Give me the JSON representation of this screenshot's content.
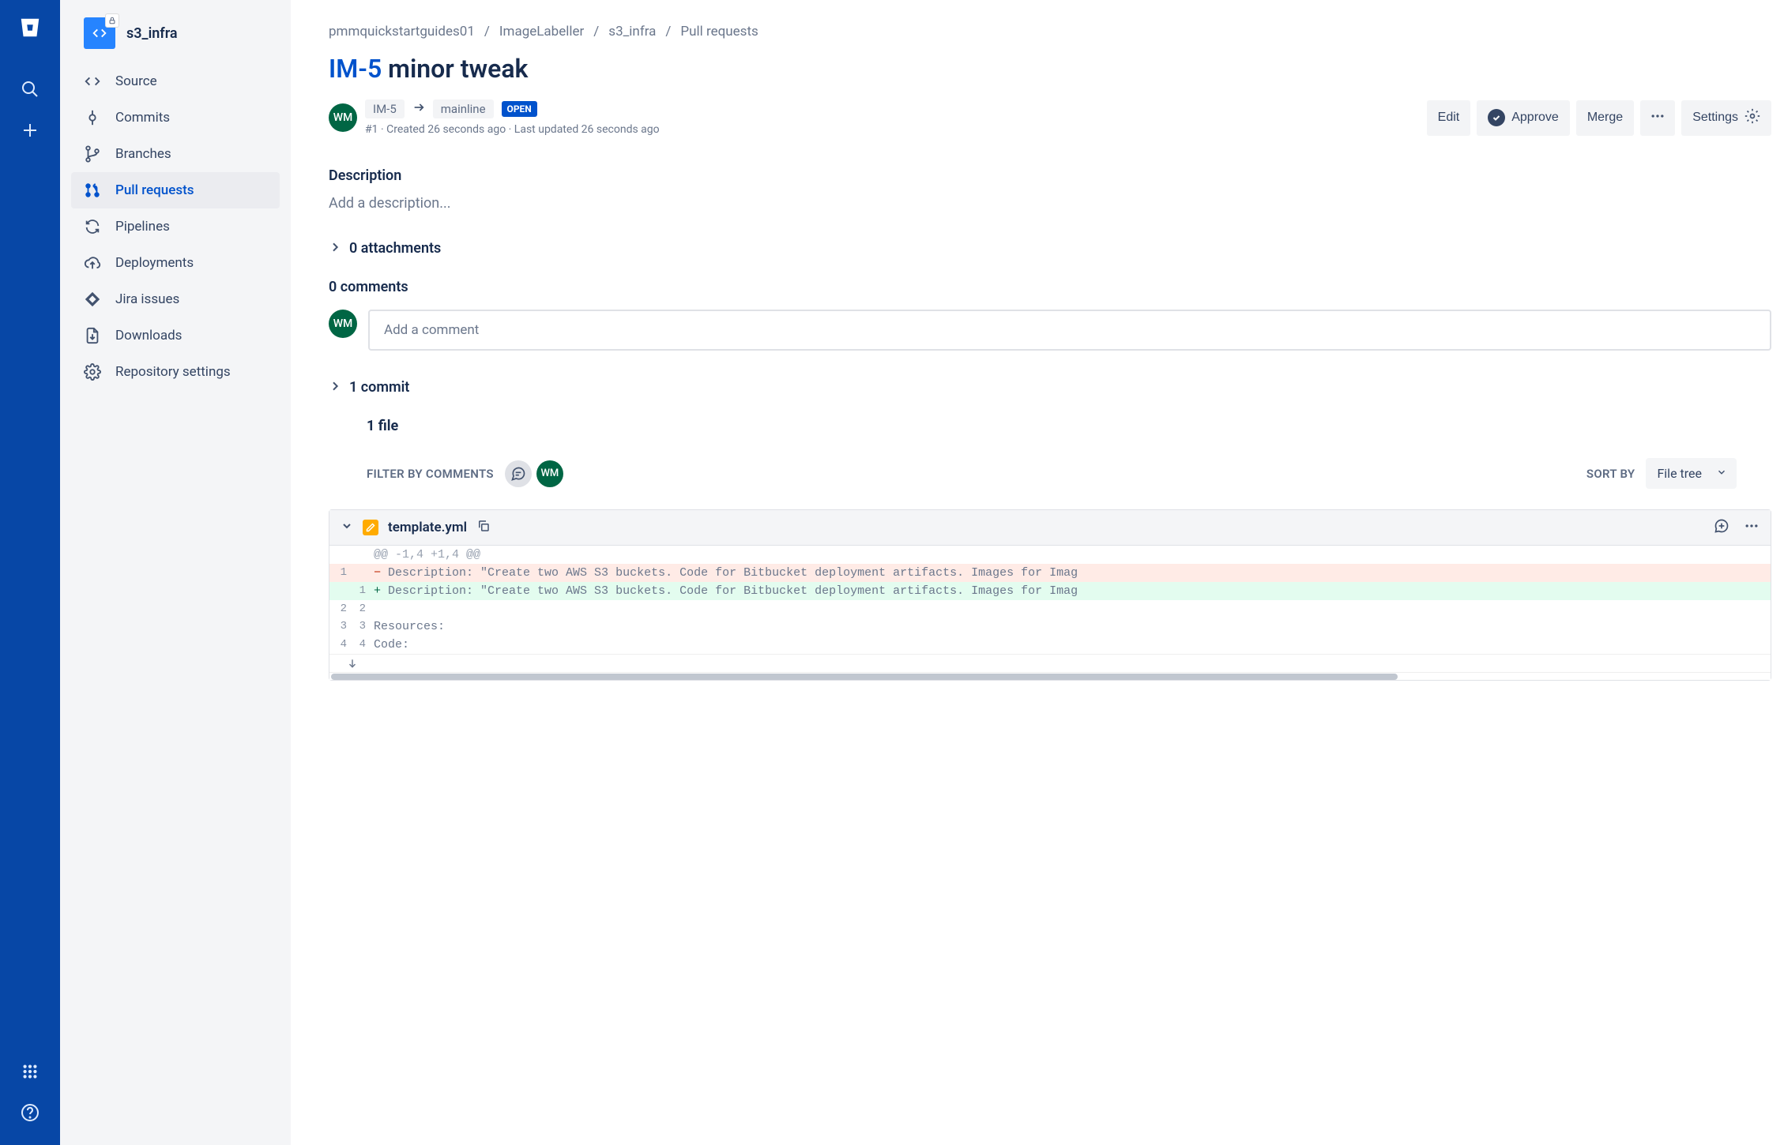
{
  "repo": {
    "name": "s3_infra"
  },
  "sidebar": {
    "items": [
      {
        "label": "Source"
      },
      {
        "label": "Commits"
      },
      {
        "label": "Branches"
      },
      {
        "label": "Pull requests"
      },
      {
        "label": "Pipelines"
      },
      {
        "label": "Deployments"
      },
      {
        "label": "Jira issues"
      },
      {
        "label": "Downloads"
      },
      {
        "label": "Repository settings"
      }
    ]
  },
  "breadcrumbs": [
    "pmmquickstartguides01",
    "ImageLabeller",
    "s3_infra",
    "Pull requests"
  ],
  "pr": {
    "issue": "IM-5",
    "title_rest": " minor tweak",
    "source_branch": "IM-5",
    "target_branch": "mainline",
    "status": "OPEN",
    "subline": "#1 · Created 26 seconds ago · Last updated 26 seconds ago",
    "author_initials": "WM"
  },
  "actions": {
    "edit": "Edit",
    "approve": "Approve",
    "merge": "Merge",
    "settings": "Settings"
  },
  "description": {
    "label": "Description",
    "placeholder": "Add a description..."
  },
  "attachments": {
    "label": "0 attachments"
  },
  "comments": {
    "label": "0 comments",
    "placeholder": "Add a comment"
  },
  "commits": {
    "label": "1 commit"
  },
  "files": {
    "count_label": "1 file",
    "filter_label": "FILTER BY COMMENTS",
    "sort_label": "SORT BY",
    "sort_value": "File tree"
  },
  "diff": {
    "filename": "template.yml",
    "hunk": "@@ -1,4 +1,4 @@",
    "lines": [
      {
        "oldno": "1",
        "newno": "",
        "type": "del",
        "sign": "−",
        "text": "Description: \"Create two AWS S3 buckets. Code for Bitbucket deployment artifacts. Images for Imag"
      },
      {
        "oldno": "",
        "newno": "1",
        "type": "add",
        "sign": "+",
        "text": "Description: \"Create two AWS S3 buckets. Code for Bitbucket deployment artifacts. Images for Imag"
      },
      {
        "oldno": "2",
        "newno": "2",
        "type": "ctx",
        "sign": " ",
        "text": ""
      },
      {
        "oldno": "3",
        "newno": "3",
        "type": "ctx",
        "sign": " ",
        "text": "  Resources:"
      },
      {
        "oldno": "4",
        "newno": "4",
        "type": "ctx",
        "sign": " ",
        "text": "    Code:"
      }
    ]
  }
}
